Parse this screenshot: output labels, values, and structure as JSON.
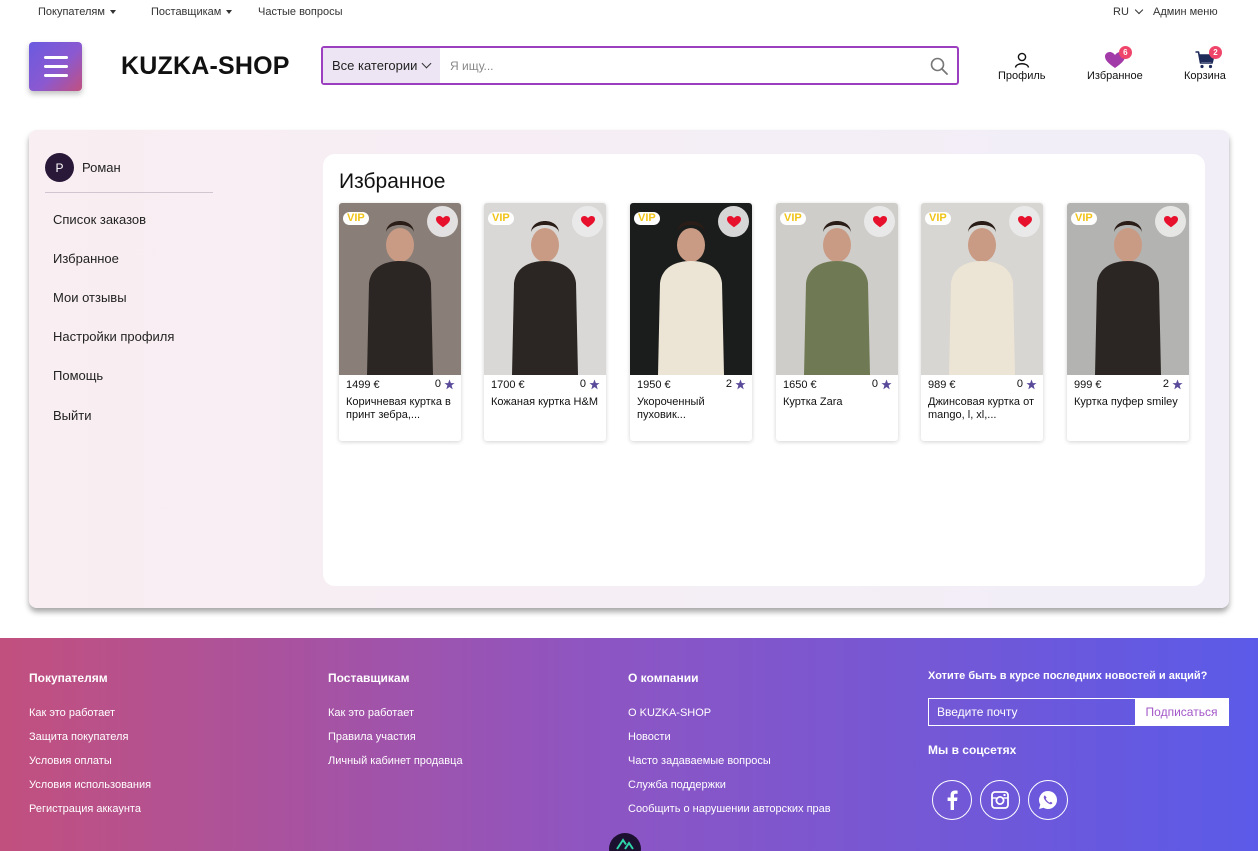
{
  "topbar": {
    "buyers": "Покупателям",
    "suppliers": "Поставщикам",
    "faq": "Частые вопросы",
    "lang": "RU",
    "admin": "Админ меню"
  },
  "header": {
    "logo": "KUZKA-SHOP",
    "category_label": "Все категории",
    "search_placeholder": "Я ищу...",
    "profile_label": "Профиль",
    "favorites_label": "Избранное",
    "favorites_count": "6",
    "cart_label": "Корзина",
    "cart_count": "2"
  },
  "sidebar": {
    "avatar_letter": "Р",
    "user_name": "Роман",
    "items": [
      {
        "label": "Список заказов"
      },
      {
        "label": "Избранное"
      },
      {
        "label": "Мои отзывы"
      },
      {
        "label": "Настройки профиля"
      },
      {
        "label": "Помощь"
      },
      {
        "label": "Выйти"
      }
    ]
  },
  "favorites": {
    "title": "Избранное",
    "products": [
      {
        "vip": "VIP",
        "price": "1499 €",
        "rating": "0",
        "name": "Коричневая куртка в принт зебра,...",
        "bg": "#8a7f78"
      },
      {
        "vip": "VIP",
        "price": "1700 €",
        "rating": "0",
        "name": "Кожаная куртка H&M",
        "bg": "#d9d8d6"
      },
      {
        "vip": "VIP",
        "price": "1950 €",
        "rating": "2",
        "name": "Укороченный пуховик...",
        "bg": "#1b1d1c"
      },
      {
        "vip": "VIP",
        "price": "1650 €",
        "rating": "0",
        "name": "Куртка Zara",
        "bg": "#cfcdca"
      },
      {
        "vip": "VIP",
        "price": "989 €",
        "rating": "0",
        "name": "Джинсовая куртка от mango, l, xl,...",
        "bg": "#d8d6d2"
      },
      {
        "vip": "VIP",
        "price": "999 €",
        "rating": "2",
        "name": "Куртка пуфер smiley",
        "bg": "#b3b3b1"
      }
    ]
  },
  "footer": {
    "col1": {
      "title": "Покупателям",
      "links": [
        "Как это работает",
        "Защита покупателя",
        "Условия оплаты",
        "Условия использования",
        "Регистрация аккаунта"
      ]
    },
    "col2": {
      "title": "Поставщикам",
      "links": [
        "Как это работает",
        "Правила участия",
        "Личный кабинет продавца"
      ]
    },
    "col3": {
      "title": "О компании",
      "links": [
        "О KUZKA-SHOP",
        "Новости",
        "Часто задаваемые вопросы",
        "Служба поддержки",
        "Сообщить о нарушении авторских прав"
      ]
    },
    "subscribe_title": "Хотите быть в курсе последних новостей и акций?",
    "email_placeholder": "Введите почту",
    "subscribe_button": "Подписаться",
    "social_title": "Мы в соцсетях"
  },
  "colors": {
    "accent": "#9b3fc0",
    "badge": "#f0456a",
    "heart": "#e8112d",
    "star": "#5a4a9a"
  }
}
